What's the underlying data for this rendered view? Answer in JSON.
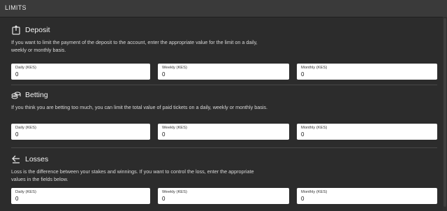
{
  "header": {
    "title": "LIMITS"
  },
  "sections": [
    {
      "icon": "deposit-box-icon",
      "title": "Deposit",
      "description": "If you want to limit the payment of the deposit to the account, enter the appropriate value for the limit on a daily, weekly or monthly basis.",
      "fields": [
        {
          "label": "Daily (KES)",
          "value": "0"
        },
        {
          "label": "Weekly (KES)",
          "value": "0"
        },
        {
          "label": "Monthly (KES)",
          "value": "0"
        }
      ]
    },
    {
      "icon": "coins-icon",
      "title": "Betting",
      "description": "If you think you are betting too much, you can limit the total value of paid tickets on a daily, weekly or monthly basis.",
      "fields": [
        {
          "label": "Daily (KES)",
          "value": "0"
        },
        {
          "label": "Weekly (KES)",
          "value": "0"
        },
        {
          "label": "Monthly (KES)",
          "value": "0"
        }
      ]
    },
    {
      "icon": "losses-arrow-icon",
      "title": "Losses",
      "description": "Loss is the difference between your stakes and winnings. If you want to control the loss, enter the appropriate values in the fields below.",
      "fields": [
        {
          "label": "Daily (KES)",
          "value": "0"
        },
        {
          "label": "Weekly (KES)",
          "value": "0"
        },
        {
          "label": "Monthly (KES)",
          "value": "0"
        }
      ]
    }
  ]
}
